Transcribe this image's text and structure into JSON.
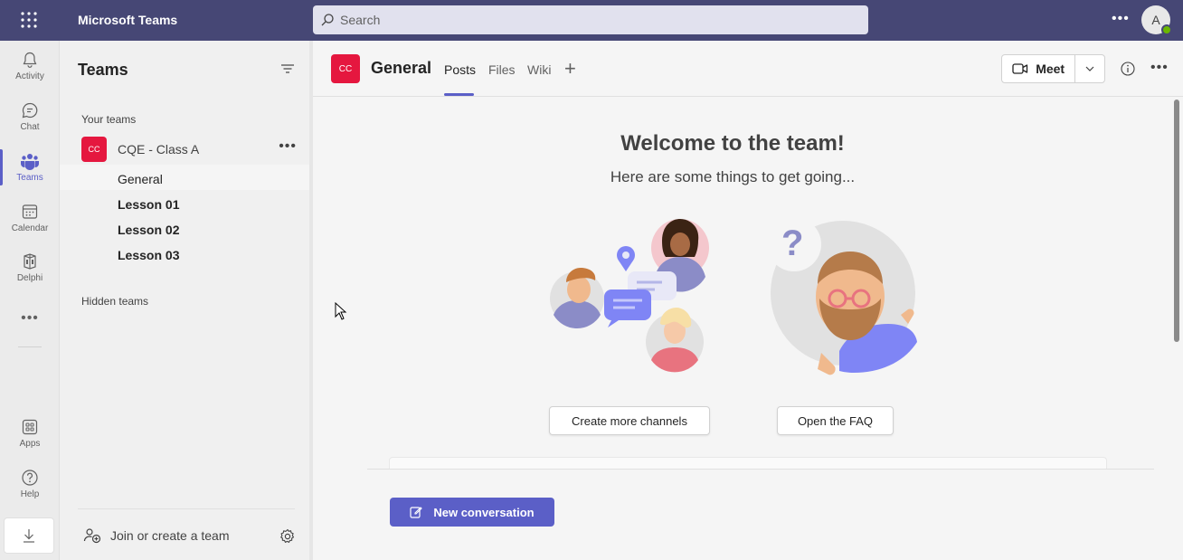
{
  "app": {
    "title": "Microsoft Teams",
    "user_initial": "A"
  },
  "search": {
    "placeholder": "Search"
  },
  "rail": {
    "items": [
      {
        "label": "Activity",
        "icon": "bell-icon"
      },
      {
        "label": "Chat",
        "icon": "chat-icon"
      },
      {
        "label": "Teams",
        "icon": "teams-icon",
        "active": true
      },
      {
        "label": "Calendar",
        "icon": "calendar-icon"
      },
      {
        "label": "Delphi",
        "icon": "delphi-icon"
      }
    ],
    "bottom": [
      {
        "label": "Apps",
        "icon": "apps-icon"
      },
      {
        "label": "Help",
        "icon": "help-icon"
      }
    ]
  },
  "panel": {
    "title": "Teams",
    "your_teams_label": "Your teams",
    "team": {
      "initials": "CC",
      "name": "CQE - Class A"
    },
    "channels": [
      "General",
      "Lesson 01",
      "Lesson 02",
      "Lesson 03"
    ],
    "hidden_teams_label": "Hidden teams",
    "join_label": "Join or create a team"
  },
  "channel": {
    "initials": "CC",
    "name": "General",
    "tabs": [
      "Posts",
      "Files",
      "Wiki"
    ],
    "meet_label": "Meet"
  },
  "main": {
    "welcome": "Welcome to the team!",
    "subtitle": "Here are some things to get going...",
    "create_channels_label": "Create more channels",
    "open_faq_label": "Open the FAQ",
    "new_conversation_label": "New conversation"
  },
  "colors": {
    "brand": "#464775",
    "accent": "#5b5fc7",
    "team_avatar": "#e5173f"
  }
}
